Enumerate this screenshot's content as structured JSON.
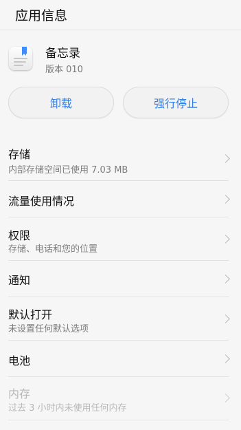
{
  "header": {
    "title": "应用信息"
  },
  "app": {
    "name": "备忘录",
    "version": "版本 010",
    "icon": "notes-app-icon"
  },
  "actions": {
    "uninstall_label": "卸载",
    "force_stop_label": "强行停止",
    "accent_color": "#2f7ce6"
  },
  "settings": {
    "storage": {
      "title": "存储",
      "subtitle": "内部存储空间已使用 7.03 MB"
    },
    "data_usage": {
      "title": "流量使用情况"
    },
    "permissions": {
      "title": "权限",
      "subtitle": "存储、电话和您的位置"
    },
    "notifications": {
      "title": "通知"
    },
    "open_by_default": {
      "title": "默认打开",
      "subtitle": "未设置任何默认选项"
    },
    "battery": {
      "title": "电池"
    },
    "memory": {
      "title": "内存",
      "subtitle": "过去 3 小时内未使用任何内存"
    }
  }
}
